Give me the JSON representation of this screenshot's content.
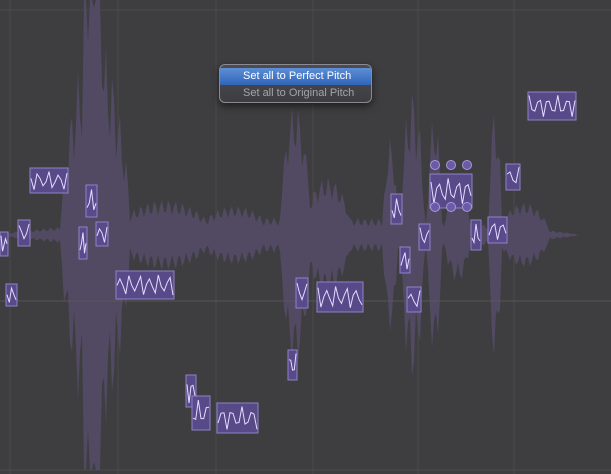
{
  "context_menu": {
    "items": [
      {
        "label": "Set all to Perfect Pitch",
        "highlighted": true
      },
      {
        "label": "Set all to Original Pitch",
        "highlighted": false
      }
    ]
  },
  "colors": {
    "background": "#3e3e40",
    "waveform": "#544b66",
    "note_fill": "#5a4a8e",
    "note_border": "#8f82c4",
    "pitch_curve": "#e6dcff",
    "grid_line": "#4a4a4d",
    "menu_highlight": "#3c72c4"
  }
}
